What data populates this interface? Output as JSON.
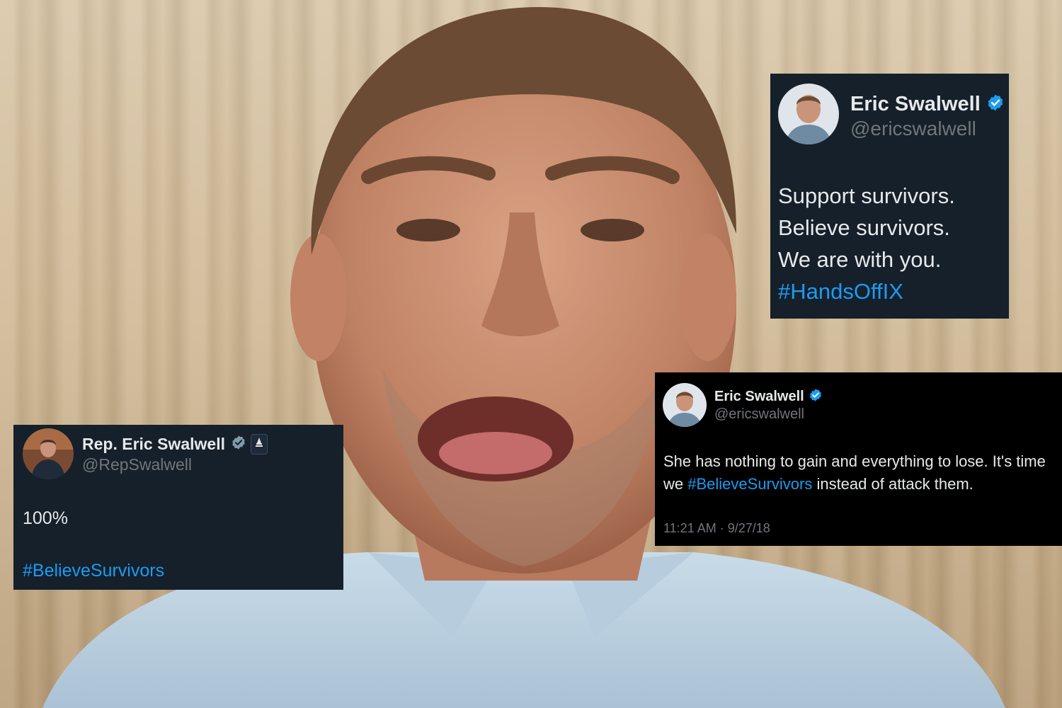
{
  "colors": {
    "card_dim_bg": "#15202b",
    "card_black_bg": "#000000",
    "text_primary": "#e7e9ea",
    "text_secondary": "#71767b",
    "hashtag": "#1d9bf0",
    "verified_badge": "#1d9bf0",
    "verified_badge_grey": "#829aab"
  },
  "tweets": [
    {
      "name": "Eric Swalwell",
      "handle": "@ericswalwell",
      "badge": "verified-blue-icon",
      "lines": [
        "Support survivors.",
        "Believe survivors.",
        "We are with you."
      ],
      "hashtag": "#HandsOffIX"
    },
    {
      "name": "Eric Swalwell",
      "handle": "@ericswalwell",
      "badge": "verified-blue-icon",
      "text_before": "She has nothing to gain and everything to lose. It's time we ",
      "hashtag": "#BelieveSurvivors",
      "text_after": " instead of attack them.",
      "timestamp": "11:21 AM · 9/27/18"
    },
    {
      "name": "Rep. Eric Swalwell",
      "handle": "@RepSwalwell",
      "badge": "verified-grey-icon",
      "secondary_badge": "government-capitol-icon",
      "text": "100%",
      "hashtag": "#BelieveSurvivors"
    }
  ]
}
